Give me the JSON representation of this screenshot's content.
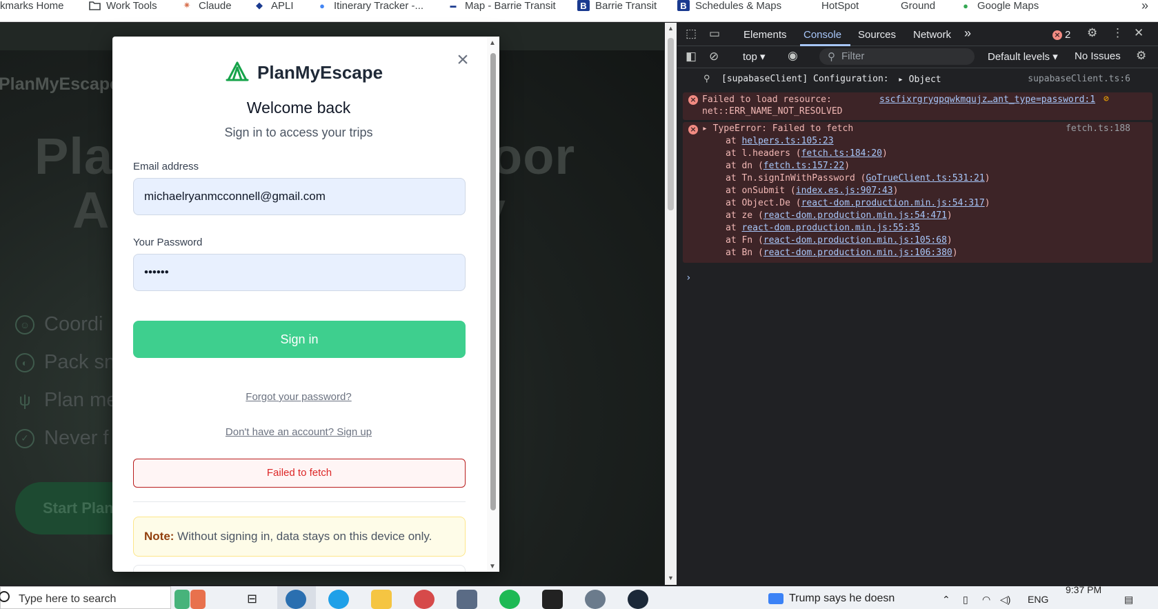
{
  "bookmarks": {
    "items": [
      {
        "label": "kmarks Home",
        "icon": ""
      },
      {
        "label": "Work Tools",
        "icon": "folder-icon"
      },
      {
        "label": "Claude",
        "icon": "claude-icon"
      },
      {
        "label": "APLI",
        "icon": "apli-icon"
      },
      {
        "label": "Itinerary Tracker -...",
        "icon": "map-pin-icon"
      },
      {
        "label": "Map - Barrie Transit",
        "icon": "transit-icon"
      },
      {
        "label": "Barrie Transit",
        "icon": "b-icon"
      },
      {
        "label": "Schedules & Maps",
        "icon": "b-icon"
      },
      {
        "label": "HotSpot",
        "icon": ""
      },
      {
        "label": "Ground",
        "icon": ""
      },
      {
        "label": "Google Maps",
        "icon": "google-maps-icon"
      }
    ],
    "more": "»"
  },
  "background_page": {
    "logo": "PlanMyEscape",
    "hero_line1": "Pla",
    "hero_line1_right": "oor",
    "hero_line2": "A",
    "hero_line2_right": "ry",
    "features": [
      "Coordi",
      "Pack sn",
      "Plan me",
      "Never f"
    ],
    "start_button": "Start Plan"
  },
  "modal": {
    "brand": "PlanMyEscape",
    "title": "Welcome back",
    "subtitle": "Sign in to access your trips",
    "email_label": "Email address",
    "email_value": "michaelryanmcconnell@gmail.com",
    "password_label": "Your Password",
    "password_value": "••••••",
    "signin_button": "Sign in",
    "forgot_link": "Forgot your password?",
    "signup_link": "Don't have an account? Sign up",
    "error_message": "Failed to fetch",
    "note_label": "Note:",
    "note_text": " Without signing in, data stays on this device only.",
    "close": "×"
  },
  "devtools": {
    "tabs": [
      "Elements",
      "Console",
      "Sources",
      "Network"
    ],
    "active_tab": "Console",
    "error_count": "2",
    "context": "top",
    "filter_placeholder": "Filter",
    "levels": "Default levels",
    "issues": "No Issues",
    "console": {
      "info_text": "[supabaseClient] Configuration:",
      "info_object": "Object",
      "info_source": "supabaseClient.ts:6",
      "err1_line1": "Failed to load resource:",
      "err1_line2": "net::ERR_NAME_NOT_RESOLVED",
      "err1_link": "sscfixrgrygpqwkmqujz…ant_type=password:1",
      "err2_head": "TypeError: Failed to fetch",
      "err2_source": "fetch.ts:188",
      "stack": [
        {
          "prefix": "at ",
          "link": "helpers.ts:105:23",
          "suffix": ""
        },
        {
          "prefix": "at l.headers (",
          "link": "fetch.ts:184:20",
          "suffix": ")"
        },
        {
          "prefix": "at dn (",
          "link": "fetch.ts:157:22",
          "suffix": ")"
        },
        {
          "prefix": "at Tn.signInWithPassword (",
          "link": "GoTrueClient.ts:531:21",
          "suffix": ")"
        },
        {
          "prefix": "at onSubmit (",
          "link": "index.es.js:907:43",
          "suffix": ")"
        },
        {
          "prefix": "at Object.De (",
          "link": "react-dom.production.min.js:54:317",
          "suffix": ")"
        },
        {
          "prefix": "at ze (",
          "link": "react-dom.production.min.js:54:471",
          "suffix": ")"
        },
        {
          "prefix": "at ",
          "link": "react-dom.production.min.js:55:35",
          "suffix": ""
        },
        {
          "prefix": "at Fn (",
          "link": "react-dom.production.min.js:105:68",
          "suffix": ")"
        },
        {
          "prefix": "at Bn (",
          "link": "react-dom.production.min.js:106:380",
          "suffix": ")"
        }
      ]
    }
  },
  "taskbar": {
    "search_placeholder": "Type here to search",
    "news": "Trump says he doesn",
    "lang": "ENG",
    "time": "9:37 PM"
  },
  "colors": {
    "brand_green": "#3ecf8e",
    "error_red": "#dc2626",
    "devtools_bg": "#202124",
    "devtools_accent": "#a8c7fa"
  }
}
